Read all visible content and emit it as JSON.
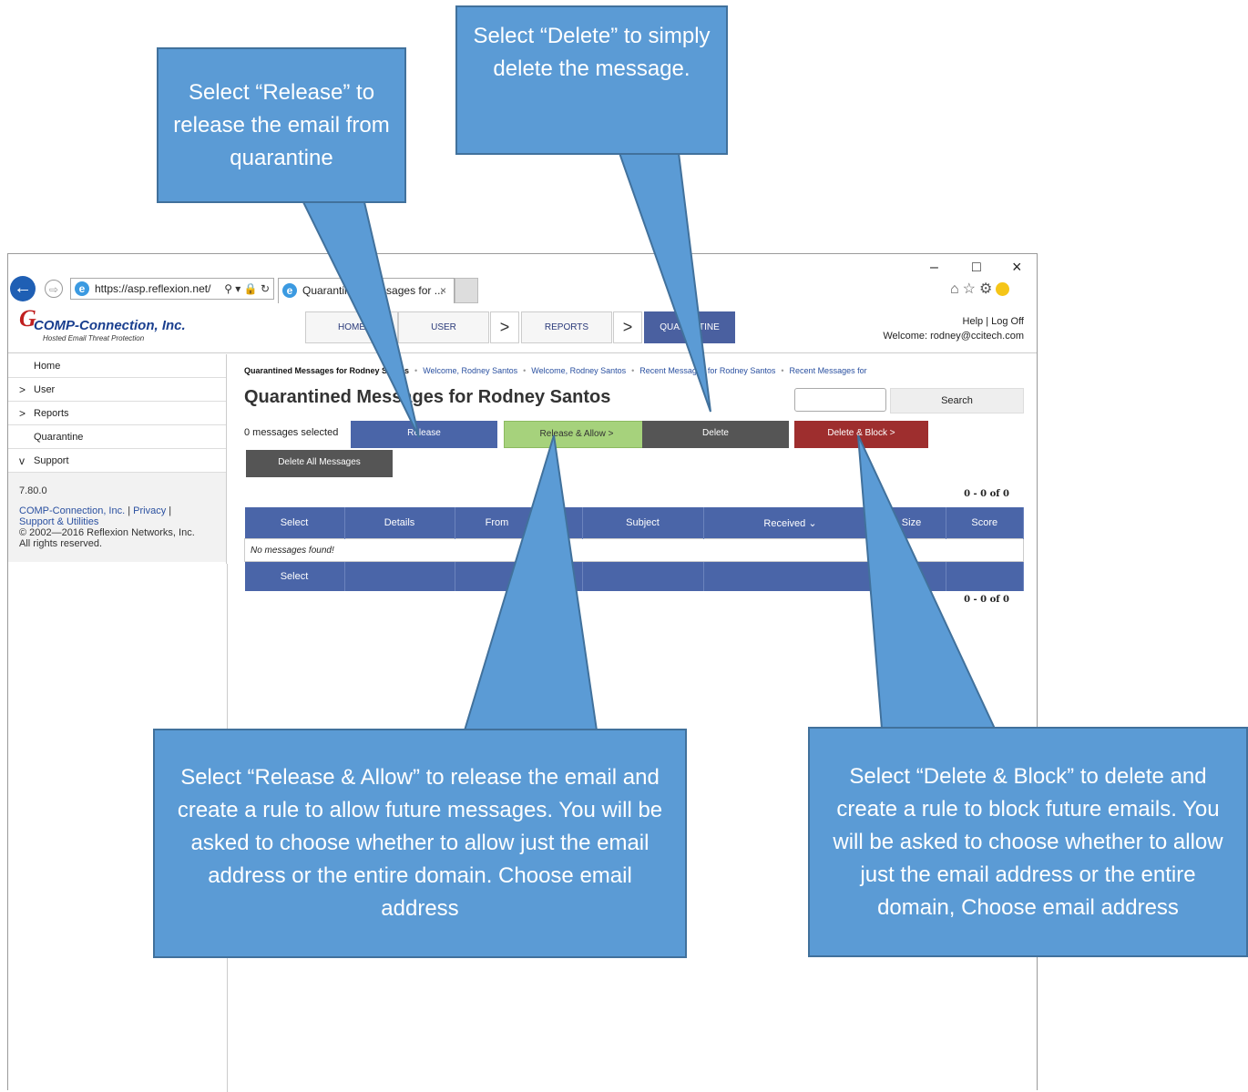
{
  "browser": {
    "url": "https://asp.reflexion.net/",
    "tab_title": "Quarantined Messages for ...",
    "tab_close": "×",
    "win_min": "–",
    "win_max": "□",
    "win_close": "×",
    "back": "←",
    "forward": "⇨",
    "ie_glyph": "e",
    "address_tools": "⚲ ▾ 🔒 ↻",
    "icons": [
      "home-icon",
      "favorites-star-icon",
      "settings-gear-icon",
      "feedback-smiley-icon"
    ]
  },
  "app": {
    "logo_mark": "G",
    "logo_name": "COMP-Connection, Inc.",
    "logo_tagline": "Hosted Email Threat Protection",
    "nav": [
      {
        "label": "HOME"
      },
      {
        "label": "USER"
      },
      {
        "label": "REPORTS"
      },
      {
        "label": "QUARANTINE"
      }
    ],
    "nav_arrow": ">",
    "header_links": "Help | Log Off",
    "welcome": "Welcome: rodney@ccitech.com"
  },
  "sidebar": {
    "items": [
      {
        "label": "Home",
        "chevron": ""
      },
      {
        "label": "User",
        "chevron": ">"
      },
      {
        "label": "Reports",
        "chevron": ">"
      },
      {
        "label": "Quarantine",
        "chevron": ""
      },
      {
        "label": "Support",
        "chevron": "v"
      }
    ],
    "version": "7.80.0",
    "company_link": "COMP-Connection, Inc.",
    "sep": "|",
    "privacy_link": "Privacy",
    "sep2": "|",
    "support_link": "Support & Utilities",
    "copyright": "© 2002—2016 Reflexion Networks, Inc.",
    "rights": "All rights reserved."
  },
  "main": {
    "breadcrumb": [
      "Quarantined Messages for Rodney Santos",
      "Welcome, Rodney Santos",
      "Welcome, Rodney Santos",
      "Recent Messages for Rodney Santos",
      "Recent Messages for"
    ],
    "title": "Quarantined Messages for Rodney Santos",
    "search_label": "Search",
    "selected_count": "0 messages selected",
    "buttons": {
      "release": "Release",
      "release_allow": "Release & Allow  >",
      "delete": "Delete",
      "delete_block": "Delete & Block  >",
      "delete_all": "Delete All Messages"
    },
    "paging_top": "0 - 0 of 0",
    "paging_bottom": "0 - 0 of 0",
    "columns": [
      "Select",
      "Details",
      "From",
      "To",
      "Subject",
      "Received ⌄",
      "Size",
      "Score"
    ],
    "empty_text": "No messages found!",
    "footer_select": "Select"
  },
  "callouts": {
    "release": "Select “Release” to release the email from quarantine",
    "delete": "Select “Delete” to simply delete the message.",
    "release_allow": "Select “Release & Allow” to release the email and create a rule to allow future messages. You will be asked to choose whether to allow just the email address or the entire domain. Choose email address",
    "delete_block": "Select “Delete & Block” to delete and create a rule to block future emails. You will be asked to choose whether to allow just the email address or the entire domain, Choose email address"
  },
  "colors": {
    "callout_fill": "#5b9bd5",
    "callout_border": "#41719c",
    "nav_active": "#4a60a0",
    "table_header": "#4a65a8",
    "release_allow": "#a6d27c",
    "delete_block": "#9e2e2e"
  }
}
